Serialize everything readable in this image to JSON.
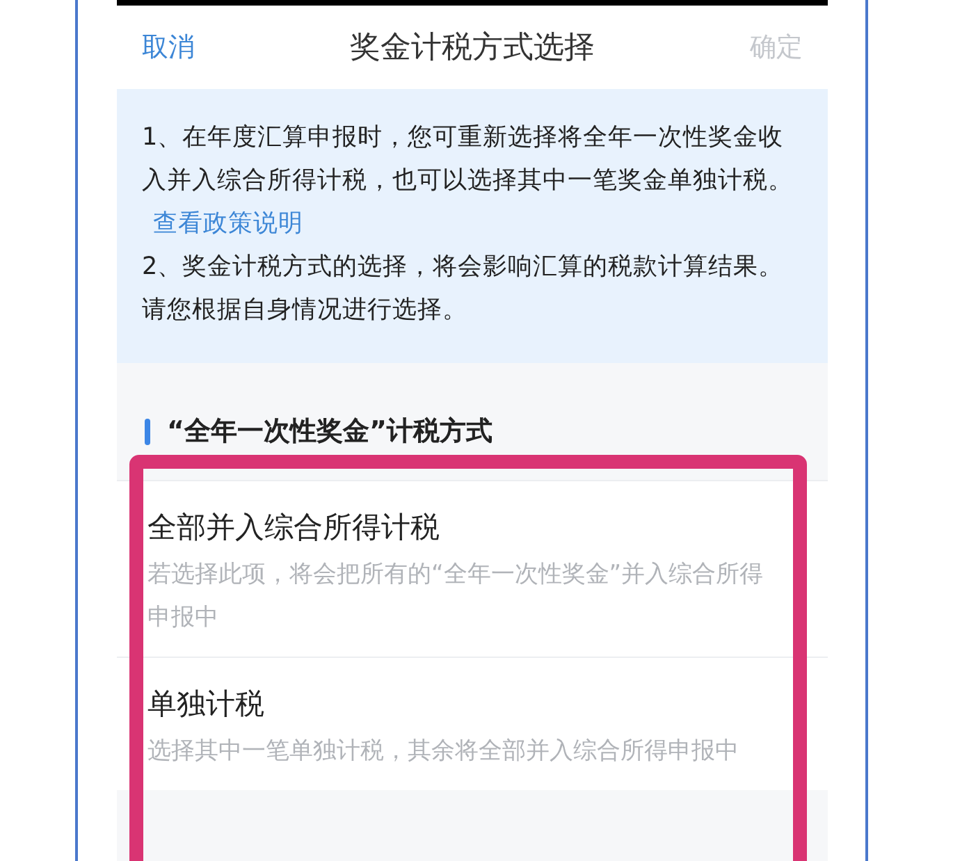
{
  "header": {
    "cancel": "取消",
    "title": "奖金计税方式选择",
    "confirm": "确定",
    "confirm_disabled": true
  },
  "notice": {
    "paragraphs": [
      {
        "text": "1、在年度汇算申报时，您可重新选择将全年一次性奖金收入并入综合所得计税，也可以选择其中一笔奖金单独计税。",
        "link": "查看政策说明"
      },
      {
        "text": "2、奖金计税方式的选择，将会影响汇算的税款计算结果。请您根据自身情况进行选择。"
      }
    ]
  },
  "section": {
    "title": "“全年一次性奖金”计税方式"
  },
  "options": [
    {
      "title": "全部并入综合所得计税",
      "description": "若选择此项，将会把所有的“全年一次性奖金”并入综合所得申报中"
    },
    {
      "title": "单独计税",
      "description": "选择其中一笔单独计税，其余将全部并入综合所得申报中"
    }
  ]
}
